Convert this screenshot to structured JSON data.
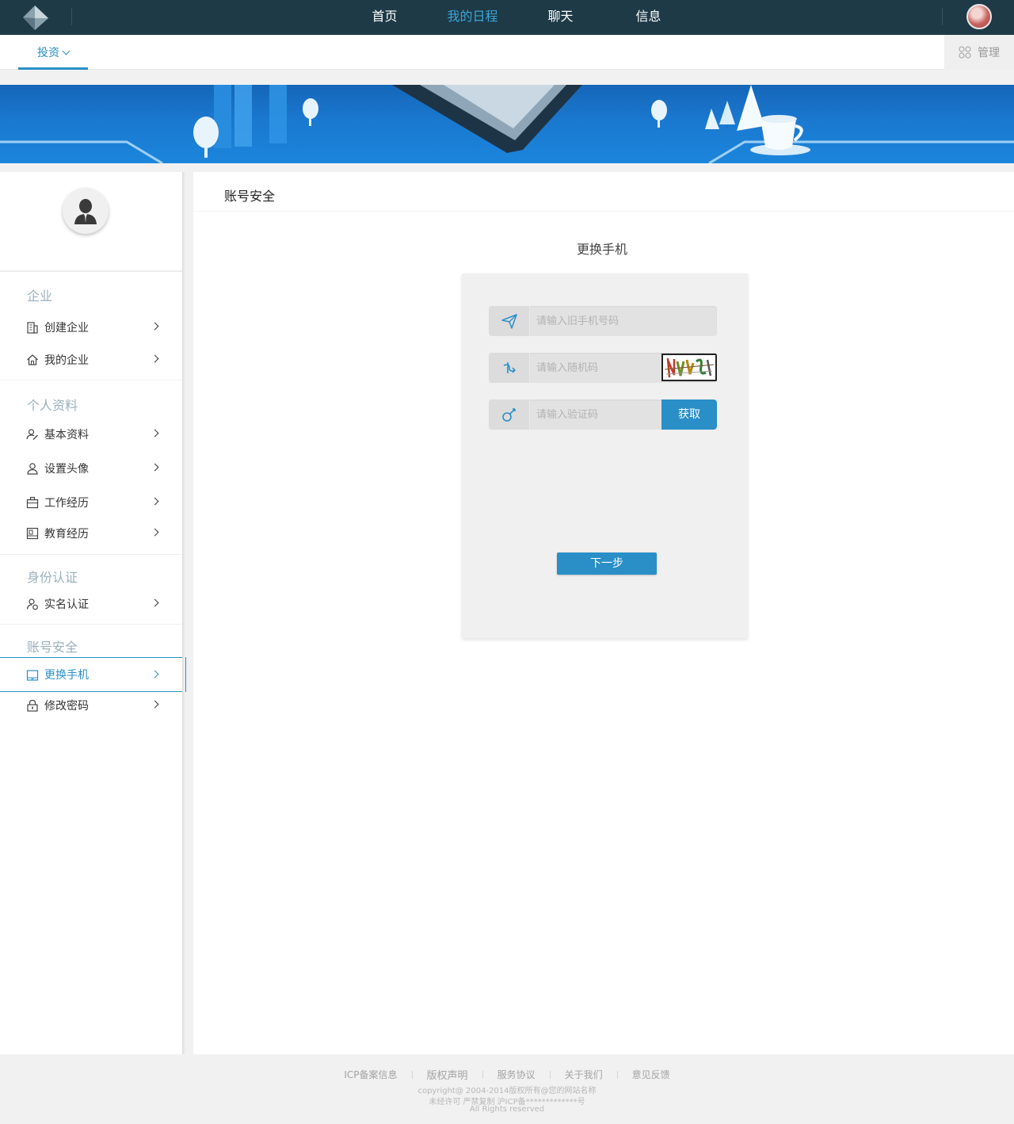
{
  "topbar": {
    "nav": [
      {
        "label": "首页",
        "active": false
      },
      {
        "label": "我的日程",
        "active": true
      },
      {
        "label": "聊天",
        "active": false
      },
      {
        "label": "信息",
        "active": false
      }
    ]
  },
  "subbar": {
    "tab_label": "投资",
    "manage_label": "管理"
  },
  "sidebar": {
    "sections": [
      {
        "title": "企业",
        "items": [
          {
            "label": "创建企业",
            "icon": "building-icon"
          },
          {
            "label": "我的企业",
            "icon": "home-icon"
          }
        ]
      },
      {
        "title": "个人资料",
        "items": [
          {
            "label": "基本资料",
            "icon": "user-edit-icon"
          },
          {
            "label": "设置头像",
            "icon": "user-icon"
          },
          {
            "label": "工作经历",
            "icon": "briefcase-icon"
          },
          {
            "label": "教育经历",
            "icon": "book-icon"
          }
        ]
      },
      {
        "title": "身份认证",
        "items": [
          {
            "label": "实名认证",
            "icon": "user-verify-icon"
          }
        ]
      },
      {
        "title": "账号安全",
        "items": [
          {
            "label": "更换手机",
            "icon": "tablet-icon",
            "active": true
          },
          {
            "label": "修改密码",
            "icon": "lock-icon"
          }
        ]
      }
    ]
  },
  "main": {
    "title": "账号安全",
    "form_title": "更换手机",
    "fields": {
      "old_phone_placeholder": "请输入旧手机号码",
      "random_code_placeholder": "请输入随机码",
      "verify_code_placeholder": "请输入验证码"
    },
    "get_button": "获取",
    "next_button": "下一步"
  },
  "footer": {
    "links": [
      "ICP备案信息",
      "版权声明",
      "服务协议",
      "关于我们",
      "意见反馈"
    ],
    "copyright": "copyright@ 2004-2014版权所有@您的网站名称",
    "license": "未经许可 严禁复制 沪ICP备*************号",
    "rights": "All Rights reserved"
  },
  "colors": {
    "topbar_bg": "#1e3a47",
    "accent": "#2a8fc7",
    "nav_active": "#3ba6d9"
  }
}
